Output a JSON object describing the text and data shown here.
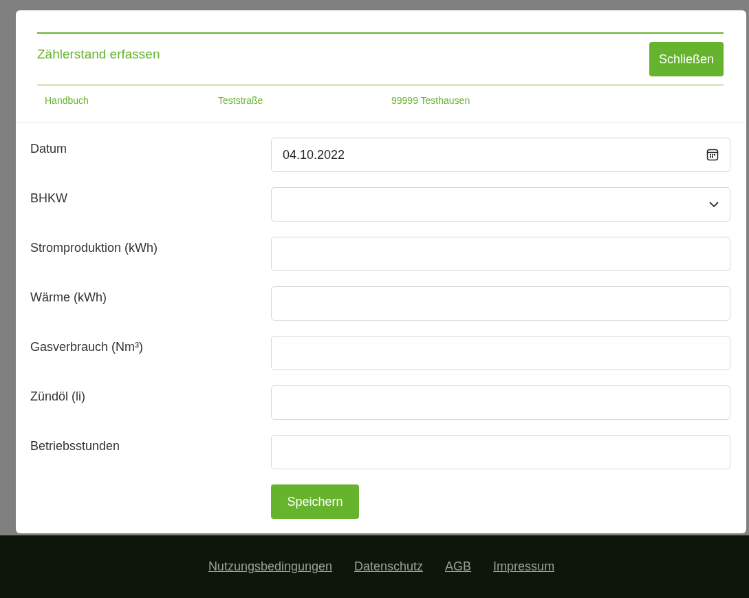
{
  "dialog": {
    "title": "Zählerstand erfassen",
    "close_button": "Schließen",
    "info": [
      "Handbuch",
      "Teststraße",
      "99999 Testhausen"
    ],
    "fields": [
      {
        "label": "Datum",
        "kind": "date",
        "value": "04.10.2022"
      },
      {
        "label": "BHKW",
        "kind": "select"
      },
      {
        "label": "Stromproduktion (kWh)",
        "kind": "text"
      },
      {
        "label": "Wärme (kWh)",
        "kind": "text"
      },
      {
        "label": "Gasverbrauch (Nm³)",
        "kind": "text"
      },
      {
        "label": "Zündöl (li)",
        "kind": "text"
      },
      {
        "label": "Betriebsstunden",
        "kind": "text"
      }
    ],
    "save_button": "Speichern"
  },
  "footer": {
    "links": [
      "Nutzungsbedingungen",
      "Datenschutz",
      "AGB",
      "Impressum"
    ]
  }
}
